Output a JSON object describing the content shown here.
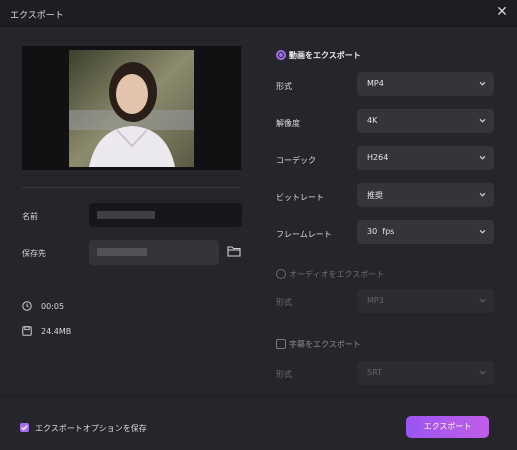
{
  "window": {
    "title": "エクスポート",
    "close_icon": "close-icon"
  },
  "left": {
    "name_label": "名前",
    "save_location_label": "保存先",
    "duration": "00:05",
    "file_size": "24.4MB"
  },
  "video_export": {
    "title": "動画をエクスポート",
    "enabled": true,
    "format": {
      "label": "形式",
      "value": "MP4"
    },
    "resolution": {
      "label": "解像度",
      "value": "4K"
    },
    "codec": {
      "label": "コーデック",
      "value": "H264"
    },
    "bitrate": {
      "label": "ビットレート",
      "value": "推奨"
    },
    "framerate": {
      "label": "フレームレート",
      "value": "30  fps"
    }
  },
  "audio_export": {
    "title": "オーディオをエクスポート",
    "enabled": false,
    "format": {
      "label": "形式",
      "value": "MP3"
    }
  },
  "subtitle_export": {
    "title": "字幕をエクスポート",
    "enabled": false,
    "format": {
      "label": "形式",
      "value": "SRT"
    }
  },
  "footer": {
    "save_options_label": "エクスポートオプションを保存",
    "save_options_checked": true,
    "export_button": "エクスポート"
  },
  "colors": {
    "accent": "#a66cf2",
    "background": "#25262b",
    "titlebar": "#1d1e22"
  }
}
